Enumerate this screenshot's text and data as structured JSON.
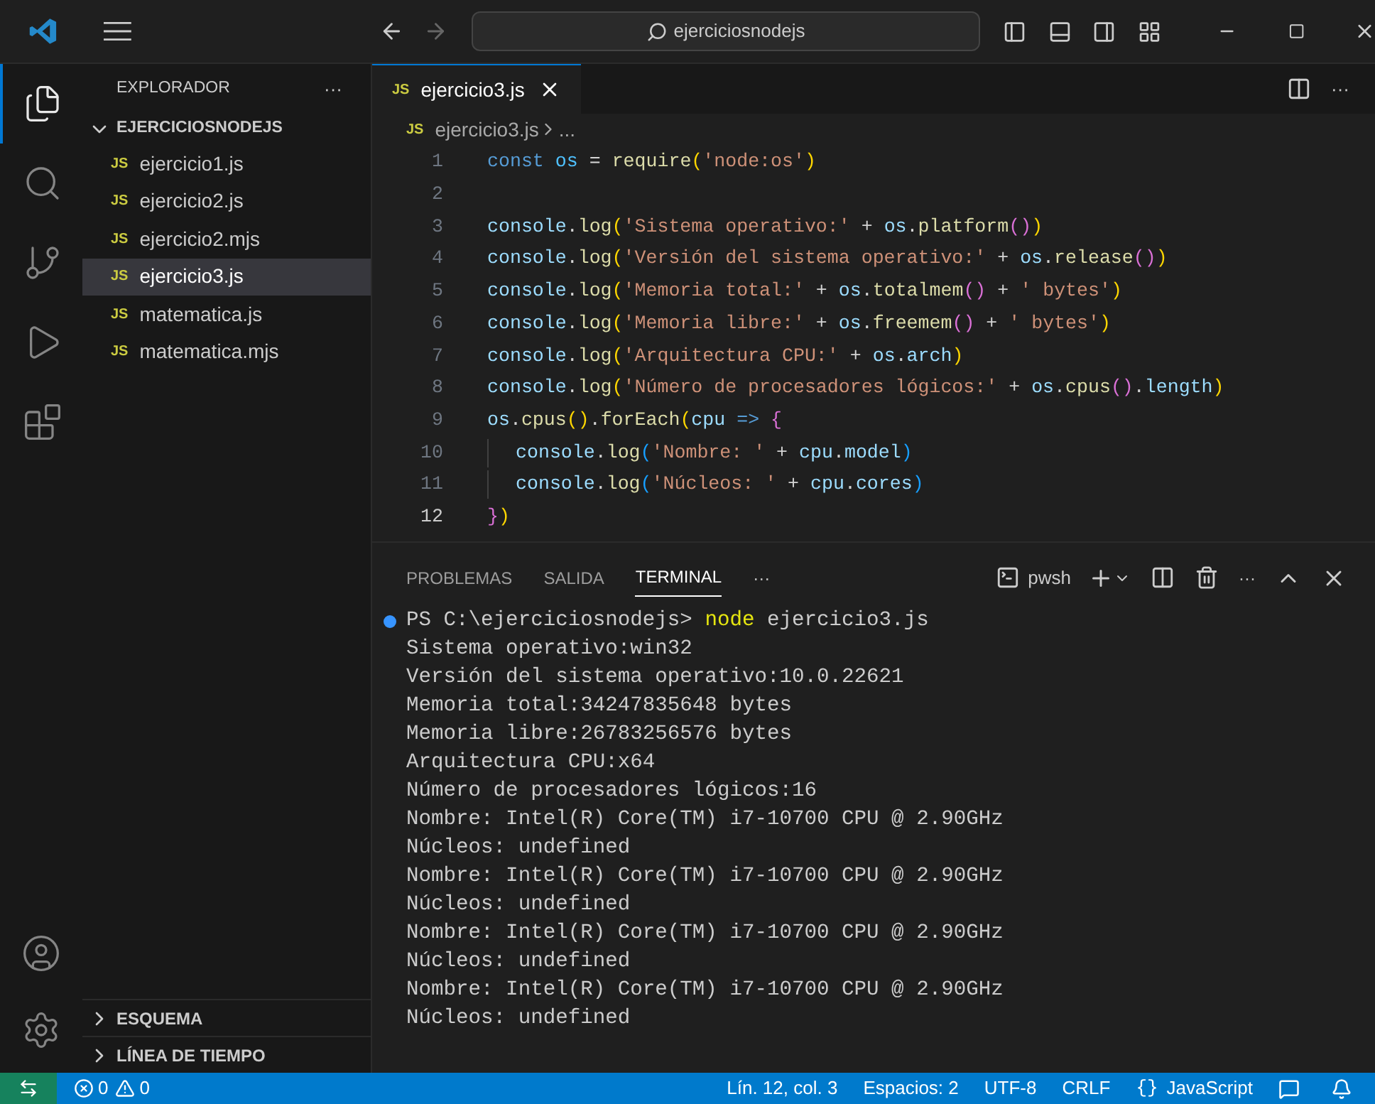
{
  "title_bar": {
    "search": "ejerciciosnodejs"
  },
  "activity_bar": [
    {
      "kind": "explorer",
      "selected": true
    },
    {
      "kind": "search",
      "selected": false
    },
    {
      "kind": "scm",
      "selected": false
    },
    {
      "kind": "debug",
      "selected": false
    },
    {
      "kind": "extensions",
      "selected": false
    }
  ],
  "sidebar": {
    "title": "EXPLORADOR",
    "more": "···",
    "folder": {
      "name": "EJERCICIOSNODEJS",
      "expanded": true,
      "files": [
        {
          "name": "ejercicio1.js",
          "badge": "JS",
          "selected": false
        },
        {
          "name": "ejercicio2.js",
          "badge": "JS",
          "selected": false
        },
        {
          "name": "ejercicio2.mjs",
          "badge": "JS",
          "selected": false
        },
        {
          "name": "ejercicio3.js",
          "badge": "JS",
          "selected": true
        },
        {
          "name": "matematica.js",
          "badge": "JS",
          "selected": false
        },
        {
          "name": "matematica.mjs",
          "badge": "JS",
          "selected": false
        }
      ]
    },
    "sections": [
      {
        "name": "ESQUEMA",
        "expanded": false
      },
      {
        "name": "LÍNEA DE TIEMPO",
        "expanded": false
      }
    ]
  },
  "tabs": [
    {
      "badge": "JS",
      "label": "ejercicio3.js",
      "selected": true
    }
  ],
  "tab_actions_more": "···",
  "breadcrumb": {
    "badge": "JS",
    "file": "ejercicio3.js",
    "rest": "..."
  },
  "code": [
    {
      "number": "1",
      "tokens": [
        {
          "kind": "kw",
          "text": "const "
        },
        {
          "kind": "const",
          "text": "os"
        },
        {
          "kind": "plain",
          "text": " = "
        },
        {
          "kind": "fn",
          "text": "require"
        },
        {
          "kind": "br1",
          "text": "("
        },
        {
          "kind": "str",
          "text": "'node:os'"
        },
        {
          "kind": "br1",
          "text": ")"
        }
      ]
    },
    {
      "number": "2"
    },
    {
      "number": "3",
      "tokens": [
        {
          "kind": "var",
          "text": "console"
        },
        {
          "kind": "plain",
          "text": "."
        },
        {
          "kind": "fn",
          "text": "log"
        },
        {
          "kind": "br1",
          "text": "("
        },
        {
          "kind": "str",
          "text": "'Sistema operativo:'"
        },
        {
          "kind": "plain",
          "text": " + "
        },
        {
          "kind": "var",
          "text": "os"
        },
        {
          "kind": "plain",
          "text": "."
        },
        {
          "kind": "fn",
          "text": "platform"
        },
        {
          "kind": "br2",
          "text": "()"
        },
        {
          "kind": "br1",
          "text": ")"
        }
      ]
    },
    {
      "number": "4",
      "tokens": [
        {
          "kind": "var",
          "text": "console"
        },
        {
          "kind": "plain",
          "text": "."
        },
        {
          "kind": "fn",
          "text": "log"
        },
        {
          "kind": "br1",
          "text": "("
        },
        {
          "kind": "str",
          "text": "'Versión del sistema operativo:'"
        },
        {
          "kind": "plain",
          "text": " + "
        },
        {
          "kind": "var",
          "text": "os"
        },
        {
          "kind": "plain",
          "text": "."
        },
        {
          "kind": "fn",
          "text": "release"
        },
        {
          "kind": "br2",
          "text": "()"
        },
        {
          "kind": "br1",
          "text": ")"
        }
      ]
    },
    {
      "number": "5",
      "tokens": [
        {
          "kind": "var",
          "text": "console"
        },
        {
          "kind": "plain",
          "text": "."
        },
        {
          "kind": "fn",
          "text": "log"
        },
        {
          "kind": "br1",
          "text": "("
        },
        {
          "kind": "str",
          "text": "'Memoria total:'"
        },
        {
          "kind": "plain",
          "text": " + "
        },
        {
          "kind": "var",
          "text": "os"
        },
        {
          "kind": "plain",
          "text": "."
        },
        {
          "kind": "fn",
          "text": "totalmem"
        },
        {
          "kind": "br2",
          "text": "()"
        },
        {
          "kind": "plain",
          "text": " + "
        },
        {
          "kind": "str",
          "text": "' bytes'"
        },
        {
          "kind": "br1",
          "text": ")"
        }
      ]
    },
    {
      "number": "6",
      "tokens": [
        {
          "kind": "var",
          "text": "console"
        },
        {
          "kind": "plain",
          "text": "."
        },
        {
          "kind": "fn",
          "text": "log"
        },
        {
          "kind": "br1",
          "text": "("
        },
        {
          "kind": "str",
          "text": "'Memoria libre:'"
        },
        {
          "kind": "plain",
          "text": " + "
        },
        {
          "kind": "var",
          "text": "os"
        },
        {
          "kind": "plain",
          "text": "."
        },
        {
          "kind": "fn",
          "text": "freemem"
        },
        {
          "kind": "br2",
          "text": "()"
        },
        {
          "kind": "plain",
          "text": " + "
        },
        {
          "kind": "str",
          "text": "' bytes'"
        },
        {
          "kind": "br1",
          "text": ")"
        }
      ]
    },
    {
      "number": "7",
      "tokens": [
        {
          "kind": "var",
          "text": "console"
        },
        {
          "kind": "plain",
          "text": "."
        },
        {
          "kind": "fn",
          "text": "log"
        },
        {
          "kind": "br1",
          "text": "("
        },
        {
          "kind": "str",
          "text": "'Arquitectura CPU:'"
        },
        {
          "kind": "plain",
          "text": " + "
        },
        {
          "kind": "var",
          "text": "os"
        },
        {
          "kind": "plain",
          "text": "."
        },
        {
          "kind": "var",
          "text": "arch"
        },
        {
          "kind": "br1",
          "text": ")"
        }
      ]
    },
    {
      "number": "8",
      "tokens": [
        {
          "kind": "var",
          "text": "console"
        },
        {
          "kind": "plain",
          "text": "."
        },
        {
          "kind": "fn",
          "text": "log"
        },
        {
          "kind": "br1",
          "text": "("
        },
        {
          "kind": "str",
          "text": "'Número de procesadores lógicos:'"
        },
        {
          "kind": "plain",
          "text": " + "
        },
        {
          "kind": "var",
          "text": "os"
        },
        {
          "kind": "plain",
          "text": "."
        },
        {
          "kind": "fn",
          "text": "cpus"
        },
        {
          "kind": "br2",
          "text": "()"
        },
        {
          "kind": "plain",
          "text": "."
        },
        {
          "kind": "var",
          "text": "length"
        },
        {
          "kind": "br1",
          "text": ")"
        }
      ]
    },
    {
      "number": "9",
      "tokens": [
        {
          "kind": "var",
          "text": "os"
        },
        {
          "kind": "plain",
          "text": "."
        },
        {
          "kind": "fn",
          "text": "cpus"
        },
        {
          "kind": "br1",
          "text": "()"
        },
        {
          "kind": "plain",
          "text": "."
        },
        {
          "kind": "fn",
          "text": "forEach"
        },
        {
          "kind": "br1",
          "text": "("
        },
        {
          "kind": "var",
          "text": "cpu "
        },
        {
          "kind": "kw",
          "text": "=> "
        },
        {
          "kind": "br2",
          "text": "{"
        }
      ]
    },
    {
      "number": "10",
      "indent": true,
      "tokens": [
        {
          "kind": "var",
          "text": "console"
        },
        {
          "kind": "plain",
          "text": "."
        },
        {
          "kind": "fn",
          "text": "log"
        },
        {
          "kind": "br3",
          "text": "("
        },
        {
          "kind": "str",
          "text": "'Nombre: '"
        },
        {
          "kind": "plain",
          "text": " + "
        },
        {
          "kind": "var",
          "text": "cpu"
        },
        {
          "kind": "plain",
          "text": "."
        },
        {
          "kind": "var",
          "text": "model"
        },
        {
          "kind": "br3",
          "text": ")"
        }
      ]
    },
    {
      "number": "11",
      "indent": true,
      "tokens": [
        {
          "kind": "var",
          "text": "console"
        },
        {
          "kind": "plain",
          "text": "."
        },
        {
          "kind": "fn",
          "text": "log"
        },
        {
          "kind": "br3",
          "text": "("
        },
        {
          "kind": "str",
          "text": "'Núcleos: '"
        },
        {
          "kind": "plain",
          "text": " + "
        },
        {
          "kind": "var",
          "text": "cpu"
        },
        {
          "kind": "plain",
          "text": "."
        },
        {
          "kind": "var",
          "text": "cores"
        },
        {
          "kind": "br3",
          "text": ")"
        }
      ]
    },
    {
      "number": "12",
      "current": true,
      "tokens": [
        {
          "kind": "br2",
          "text": "}"
        },
        {
          "kind": "br1",
          "text": ")"
        }
      ]
    }
  ],
  "panel": {
    "tabs": [
      {
        "label": "PROBLEMAS",
        "selected": false
      },
      {
        "label": "SALIDA",
        "selected": false
      },
      {
        "label": "TERMINAL",
        "selected": true
      }
    ],
    "more": "···",
    "shell": "pwsh",
    "actions_more": "···"
  },
  "terminal": {
    "prompt": "PS C:\\ejerciciosnodejs> ",
    "command": "node",
    "args": " ejercicio3.js",
    "output": [
      "Sistema operativo:win32",
      "Versión del sistema operativo:10.0.22621",
      "Memoria total:34247835648 bytes",
      "Memoria libre:26783256576 bytes",
      "Arquitectura CPU:x64",
      "Número de procesadores lógicos:16",
      "Nombre: Intel(R) Core(TM) i7-10700 CPU @ 2.90GHz",
      "Núcleos: undefined",
      "Nombre: Intel(R) Core(TM) i7-10700 CPU @ 2.90GHz",
      "Núcleos: undefined",
      "Nombre: Intel(R) Core(TM) i7-10700 CPU @ 2.90GHz",
      "Núcleos: undefined",
      "Nombre: Intel(R) Core(TM) i7-10700 CPU @ 2.90GHz",
      "Núcleos: undefined"
    ]
  },
  "status_bar": {
    "errors": "0",
    "warnings": "0",
    "items": [
      "Lín. 12, col. 3",
      "Espacios: 2",
      "UTF-8",
      "CRLF"
    ],
    "language_brace": "{}",
    "language": "JavaScript"
  }
}
